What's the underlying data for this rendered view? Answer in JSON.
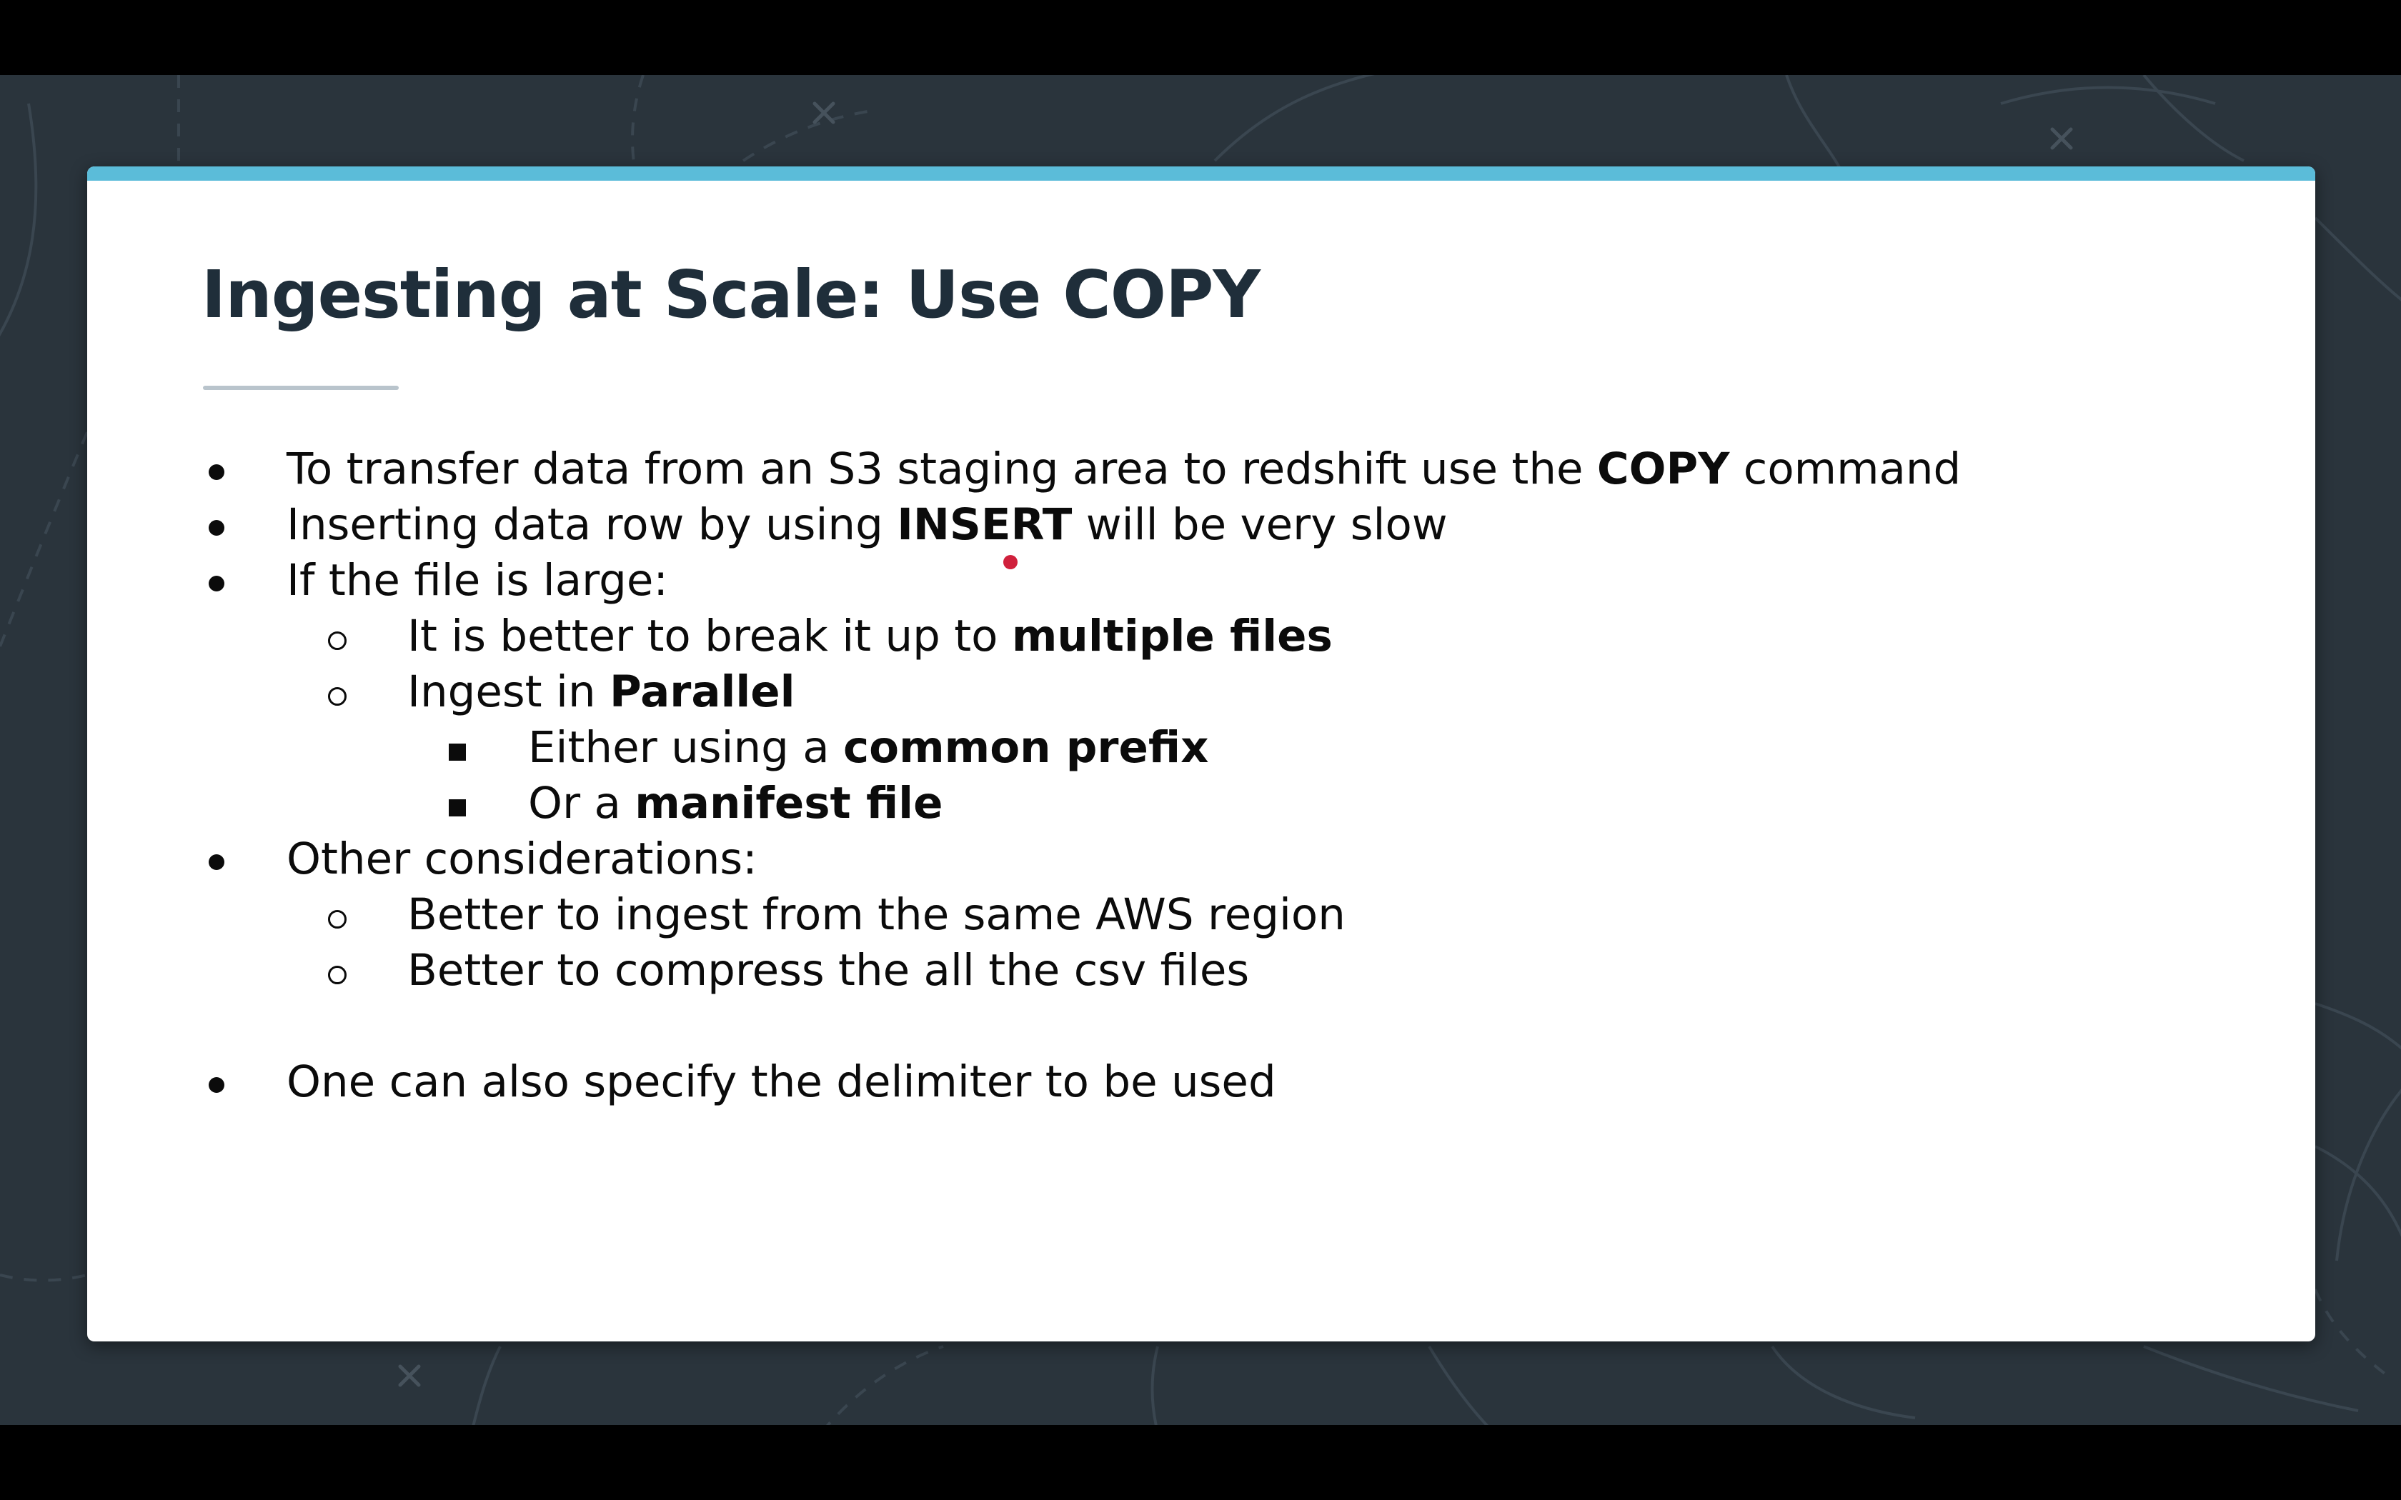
{
  "colors": {
    "letterbox": "#000000",
    "background": "#2a343c",
    "slide_accent": "#5bbcd9",
    "title": "#1f2e3a",
    "body_text": "#0b0b0b",
    "pointer": "#d0203c"
  },
  "slide": {
    "title": "Ingesting at Scale: Use COPY",
    "bullets": [
      {
        "marker": "disc",
        "parts": [
          "To transfer data from an S3 staging area to redshift use the ",
          "COPY",
          " command"
        ]
      },
      {
        "marker": "disc",
        "parts": [
          "Inserting data row by using ",
          "INSERT",
          " will be very slow"
        ]
      },
      {
        "marker": "disc",
        "parts": [
          "If the file is large:"
        ]
      },
      {
        "marker": "circle",
        "parts": [
          "It is better to break it up to ",
          "multiple files"
        ]
      },
      {
        "marker": "circle",
        "parts": [
          "Ingest in ",
          "Parallel"
        ]
      },
      {
        "marker": "square",
        "parts": [
          "Either using a ",
          "common prefix"
        ]
      },
      {
        "marker": "square",
        "parts": [
          "Or a ",
          "manifest file"
        ]
      },
      {
        "marker": "disc",
        "parts": [
          "Other considerations:"
        ]
      },
      {
        "marker": "circle",
        "parts": [
          "Better to ingest from the same AWS region"
        ]
      },
      {
        "marker": "circle",
        "parts": [
          "Better to compress the all the csv files"
        ]
      },
      {
        "marker": "disc",
        "parts": [
          "One can also specify the delimiter to be used"
        ]
      }
    ]
  },
  "icons": {
    "pointer": "laser-pointer-dot",
    "background_decor": "map-line-pattern"
  }
}
